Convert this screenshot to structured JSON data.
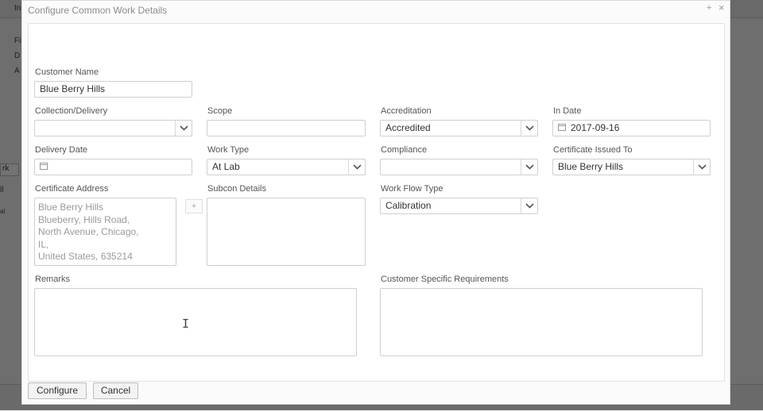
{
  "modal": {
    "title": "Configure Common Work Details",
    "maximize": "+",
    "close": "×"
  },
  "background": {
    "top_letter": "In",
    "rows": [
      "Fi",
      "D",
      "A"
    ],
    "side_button": "rk",
    "side_texts": [
      "ll",
      "al"
    ]
  },
  "form": {
    "customer_name": {
      "label": "Customer Name",
      "value": "Blue Berry Hills"
    },
    "collection_delivery": {
      "label": "Collection/Delivery",
      "value": ""
    },
    "scope": {
      "label": "Scope",
      "value": ""
    },
    "accreditation": {
      "label": "Accreditation",
      "value": "Accredited"
    },
    "in_date": {
      "label": "In Date",
      "value": "2017-09-16"
    },
    "delivery_date": {
      "label": "Delivery Date",
      "value": ""
    },
    "work_type": {
      "label": "Work Type",
      "value": "At Lab"
    },
    "compliance": {
      "label": "Compliance",
      "value": ""
    },
    "certificate_issued_to": {
      "label": "Certificate Issued To",
      "value": "Blue Berry Hills"
    },
    "certificate_address": {
      "label": "Certificate Address",
      "lines": [
        "Blue Berry Hills",
        "Blueberry, Hills Road,",
        "North Avenue, Chicago,",
        "IL,",
        "United States, 635214"
      ]
    },
    "subcon_details": {
      "label": "Subcon Details",
      "add": "+"
    },
    "work_flow_type": {
      "label": "Work Flow Type",
      "value": "Calibration"
    },
    "remarks": {
      "label": "Remarks"
    },
    "customer_specific_requirements": {
      "label": "Customer Specific Requirements"
    }
  },
  "footer": {
    "configure": "Configure",
    "cancel": "Cancel"
  }
}
